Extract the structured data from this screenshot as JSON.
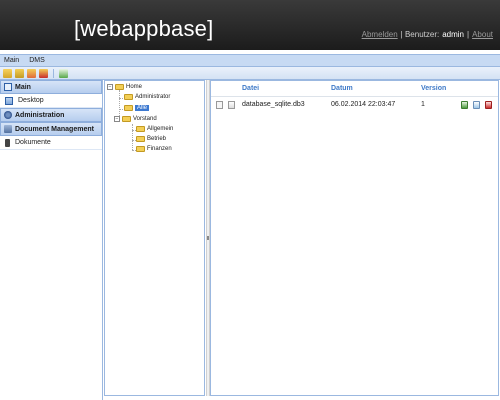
{
  "header": {
    "brand": "[webappbase]",
    "logout": "Abmelden",
    "user_label": "| Benutzer:",
    "user": "admin",
    "about_sep": "|",
    "about": "About"
  },
  "menu": [
    "Main",
    "DMS"
  ],
  "toolbar_icons": [
    "add-icon",
    "folder-icon",
    "upload-icon",
    "delete-icon",
    "new-document-icon"
  ],
  "nav": {
    "main_title": "Main",
    "desktop": "Desktop",
    "admin_title": "Administration",
    "dms_title": "Document Management",
    "dokumente": "Dokumente"
  },
  "tree": {
    "home": "Home",
    "administrator": "Administrator",
    "alle": "Alle",
    "vorstand": "Vorstand",
    "allgemein": "Allgemein",
    "betrieb": "Betrieb",
    "finanzen": "Finanzen",
    "toggle_open": "−"
  },
  "grid": {
    "headers": {
      "datei": "Datei",
      "datum": "Datum",
      "version": "Version"
    },
    "rows": [
      {
        "datei": "database_sqlite.db3",
        "datum": "06.02.2014 22:03:47",
        "version": "1"
      }
    ]
  },
  "colors": {
    "header_bg": "#2a2a2a",
    "accent": "#3f7ac8",
    "menu_bg": "#c7daf3"
  }
}
